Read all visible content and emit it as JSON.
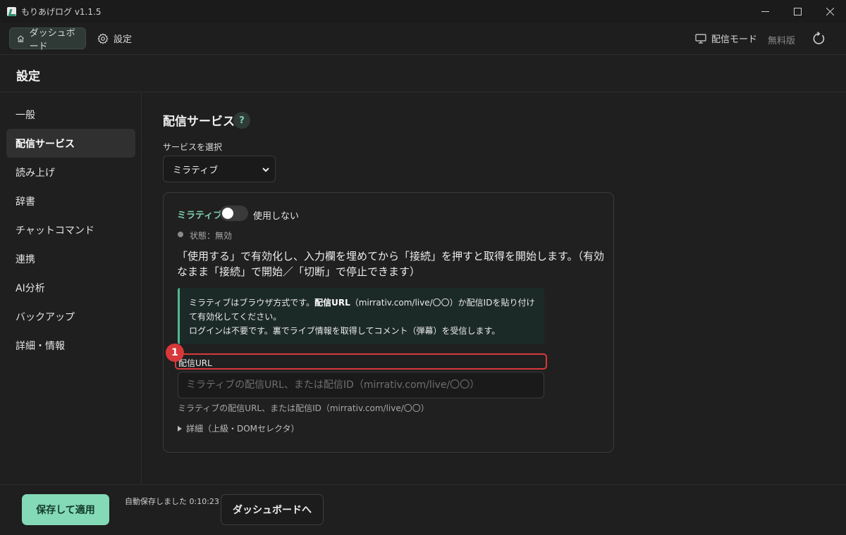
{
  "window": {
    "title": "もりあげログ v1.1.5"
  },
  "topnav": {
    "dashboard_label": "ダッシュボード",
    "settings_label": "設定",
    "broadcast_mode_label": "配信モード",
    "free_label": "無料版"
  },
  "page": {
    "title": "設定"
  },
  "sidebar": {
    "items": [
      {
        "label": "一般"
      },
      {
        "label": "配信サービス"
      },
      {
        "label": "読み上げ"
      },
      {
        "label": "辞書"
      },
      {
        "label": "チャットコマンド"
      },
      {
        "label": "連携"
      },
      {
        "label": "AI分析"
      },
      {
        "label": "バックアップ"
      },
      {
        "label": "詳細・情報"
      }
    ],
    "active_index": 1
  },
  "main": {
    "section_title": "配信サービス",
    "help_label": "?",
    "select_label": "サービスを選択",
    "selected_service": "ミラティブ",
    "card": {
      "service_name": "ミラティブ",
      "toggle_label": "使用しない",
      "toggle_on": false,
      "status_text": "状態：無効",
      "description": "「使用する」で有効化し、入力欄を埋めてから「接続」を押すと取得を開始します。（有効なまま「接続」で開始／「切断」で停止できます）",
      "info_line1_prefix": "ミラティブはブラウザ方式です。",
      "info_line1_bold": "配信URL",
      "info_line1_suffix": "（mirrativ.com/live/〇〇）か配信IDを貼り付けて有効化してください。",
      "info_line2": "ログインは不要です。裏でライブ情報を取得してコメント（弾幕）を受信します。",
      "field_label": "配信URL",
      "marker_number": "1",
      "url_placeholder": "ミラティブの配信URL、または配信ID（mirrativ.com/live/〇〇）",
      "url_value": "",
      "hint": "ミラティブの配信URL、または配信ID（mirrativ.com/live/〇〇）",
      "details_label": "詳細（上級・DOMセレクタ）"
    }
  },
  "footer": {
    "save_label": "保存して適用",
    "autosave_text": "自動保存しました 0:10:23",
    "dashboard_label": "ダッシュボードへ"
  },
  "colors": {
    "accent": "#84d9b7",
    "accent_text": "#7fd1b0",
    "highlight_red": "#d9383a",
    "background": "#1f1f1f"
  }
}
